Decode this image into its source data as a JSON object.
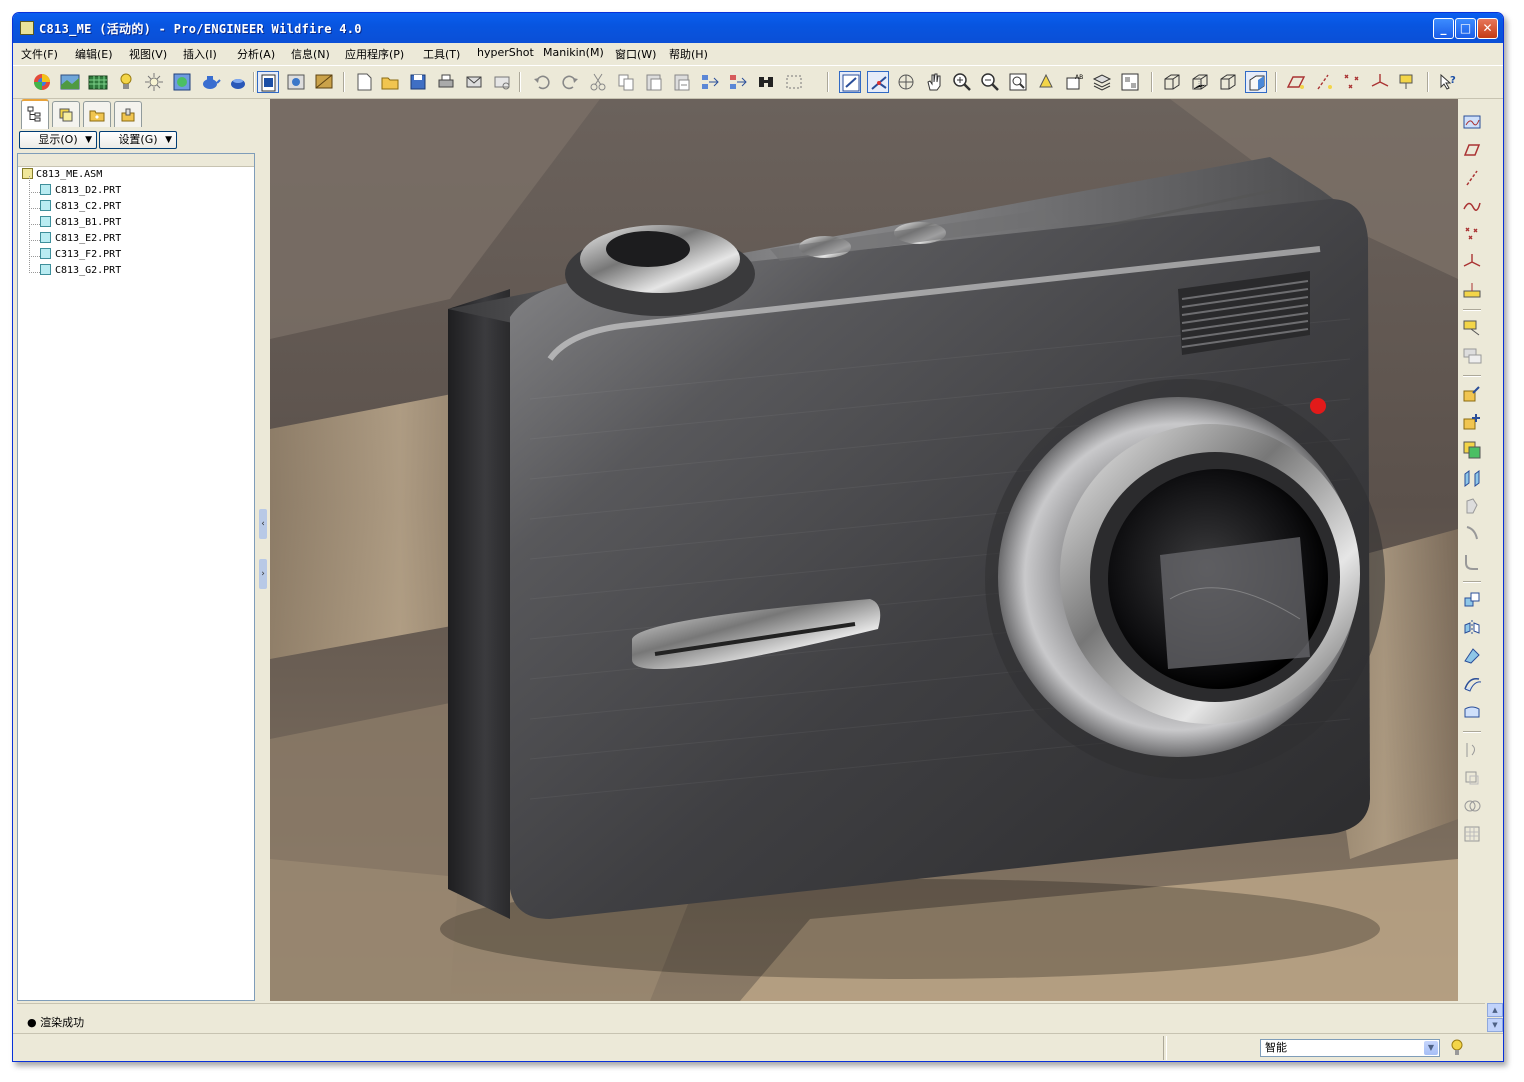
{
  "window": {
    "title": "C813_ME (活动的) - Pro/ENGINEER Wildfire 4.0"
  },
  "menu": [
    "文件(F)",
    "编辑(E)",
    "视图(V)",
    "插入(I)",
    "分析(A)",
    "信息(N)",
    "应用程序(P)",
    "工具(T)",
    "hyperShot",
    "Manikin(M)",
    "窗口(W)",
    "帮助(H)"
  ],
  "navigator": {
    "show_label": "显示(O)",
    "settings_label": "设置(G)",
    "tabs": [
      "model-tree-icon",
      "layers-icon",
      "folder-icon",
      "favorites-icon"
    ]
  },
  "tree": {
    "root": "C813_ME.ASM",
    "items": [
      "C813_D2.PRT",
      "C813_C2.PRT",
      "C813_B1.PRT",
      "C813_E2.PRT",
      "C313_F2.PRT",
      "C813_G2.PRT"
    ]
  },
  "message": {
    "text": "渲染成功"
  },
  "status": {
    "filter_value": "智能"
  },
  "colors": {
    "titlebar": "#0a5ff0",
    "chrome": "#ece9d8",
    "accent": "#316ac5"
  }
}
